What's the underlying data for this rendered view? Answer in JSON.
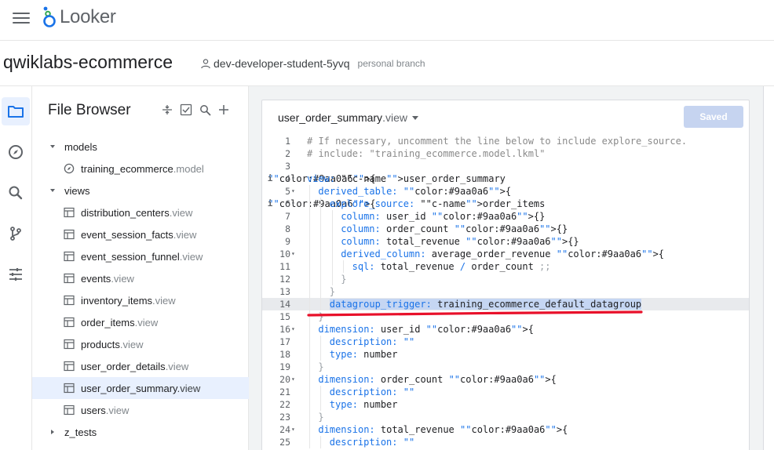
{
  "app": {
    "name": "Looker",
    "menu_icon": "hamburger-menu-icon"
  },
  "project": {
    "title": "qwiklabs-ecommerce",
    "branch_user": "dev-developer-student-5yvq",
    "branch_type": "personal branch"
  },
  "rail": {
    "items": [
      {
        "name": "folder-icon",
        "active": true
      },
      {
        "name": "compass-icon",
        "active": false
      },
      {
        "name": "search-icon",
        "active": false
      },
      {
        "name": "git-branch-icon",
        "active": false
      },
      {
        "name": "settings-sliders-icon",
        "active": false
      }
    ]
  },
  "file_browser": {
    "title": "File Browser",
    "tools": [
      "collapse-icon",
      "checklist-icon",
      "search-icon",
      "add-icon"
    ],
    "items": [
      {
        "type": "folder",
        "name": "models",
        "ext": "",
        "level": 0,
        "expanded": true
      },
      {
        "type": "model",
        "name": "training_ecommerce",
        "ext": ".model",
        "level": 1
      },
      {
        "type": "folder",
        "name": "views",
        "ext": "",
        "level": 0,
        "expanded": true
      },
      {
        "type": "view",
        "name": "distribution_centers",
        "ext": ".view",
        "level": 1
      },
      {
        "type": "view",
        "name": "event_session_facts",
        "ext": ".view",
        "level": 1
      },
      {
        "type": "view",
        "name": "event_session_funnel",
        "ext": ".view",
        "level": 1
      },
      {
        "type": "view",
        "name": "events",
        "ext": ".view",
        "level": 1
      },
      {
        "type": "view",
        "name": "inventory_items",
        "ext": ".view",
        "level": 1
      },
      {
        "type": "view",
        "name": "order_items",
        "ext": ".view",
        "level": 1
      },
      {
        "type": "view",
        "name": "products",
        "ext": ".view",
        "level": 1
      },
      {
        "type": "view",
        "name": "user_order_details",
        "ext": ".view",
        "level": 1
      },
      {
        "type": "view",
        "name": "user_order_summary",
        "ext": ".view",
        "level": 1,
        "selected": true
      },
      {
        "type": "view",
        "name": "users",
        "ext": ".view",
        "level": 1
      },
      {
        "type": "folder",
        "name": "z_tests",
        "ext": "",
        "level": 0,
        "expanded": false
      }
    ]
  },
  "editor": {
    "file_name": "user_order_summary",
    "file_ext": ".view",
    "saved_label": "Saved",
    "lines": [
      {
        "n": "1",
        "info": "",
        "fold": "",
        "indent": 0,
        "text": "# If necessary, uncomment the line below to include explore_source."
      },
      {
        "n": "2",
        "info": "",
        "fold": "",
        "indent": 0,
        "text": "# include: \"training_ecommerce.model.lkml\""
      },
      {
        "n": "3",
        "info": "",
        "fold": "",
        "indent": 0,
        "text": ""
      },
      {
        "n": "4",
        "info": "i",
        "fold": "▾",
        "indent": 0,
        "text": "view: user_order_summary {"
      },
      {
        "n": "5",
        "info": "",
        "fold": "▾",
        "indent": 1,
        "text": "derived_table: {"
      },
      {
        "n": "6",
        "info": "i",
        "fold": "▾",
        "indent": 2,
        "text": "explore_source: order_items {"
      },
      {
        "n": "7",
        "info": "",
        "fold": "",
        "indent": 3,
        "text": "column: user_id {}"
      },
      {
        "n": "8",
        "info": "",
        "fold": "",
        "indent": 3,
        "text": "column: order_count {}"
      },
      {
        "n": "9",
        "info": "",
        "fold": "",
        "indent": 3,
        "text": "column: total_revenue {}"
      },
      {
        "n": "10",
        "info": "",
        "fold": "▾",
        "indent": 3,
        "text": "derived_column: average_order_revenue {"
      },
      {
        "n": "11",
        "info": "",
        "fold": "",
        "indent": 4,
        "text": "sql: total_revenue / order_count ;;"
      },
      {
        "n": "12",
        "info": "",
        "fold": "",
        "indent": 3,
        "text": "}"
      },
      {
        "n": "13",
        "info": "",
        "fold": "",
        "indent": 2,
        "text": "}"
      },
      {
        "n": "14",
        "info": "",
        "fold": "",
        "indent": 2,
        "text": "datagroup_trigger: training_ecommerce_default_datagroup",
        "highlight": true
      },
      {
        "n": "15",
        "info": "",
        "fold": "",
        "indent": 1,
        "text": "}"
      },
      {
        "n": "16",
        "info": "",
        "fold": "▾",
        "indent": 1,
        "text": "dimension: user_id {"
      },
      {
        "n": "17",
        "info": "",
        "fold": "",
        "indent": 2,
        "text": "description: \"\""
      },
      {
        "n": "18",
        "info": "",
        "fold": "",
        "indent": 2,
        "text": "type: number"
      },
      {
        "n": "19",
        "info": "",
        "fold": "",
        "indent": 1,
        "text": "}"
      },
      {
        "n": "20",
        "info": "",
        "fold": "▾",
        "indent": 1,
        "text": "dimension: order_count {"
      },
      {
        "n": "21",
        "info": "",
        "fold": "",
        "indent": 2,
        "text": "description: \"\""
      },
      {
        "n": "22",
        "info": "",
        "fold": "",
        "indent": 2,
        "text": "type: number"
      },
      {
        "n": "23",
        "info": "",
        "fold": "",
        "indent": 1,
        "text": "}"
      },
      {
        "n": "24",
        "info": "",
        "fold": "▾",
        "indent": 1,
        "text": "dimension: total_revenue {"
      },
      {
        "n": "25",
        "info": "",
        "fold": "",
        "indent": 2,
        "text": "description: \"\""
      }
    ]
  },
  "colors": {
    "keyword": "#1a73e8",
    "selection": "#c5d6f3",
    "annotation": "#e8102a",
    "saved_button": "#c6d4f0"
  }
}
